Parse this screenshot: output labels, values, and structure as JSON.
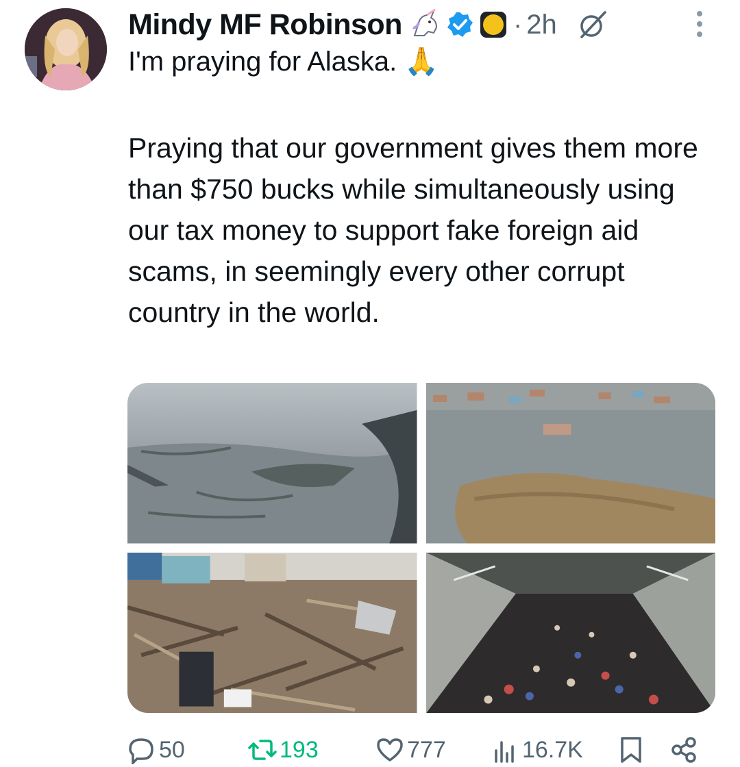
{
  "post": {
    "author": {
      "name": "Mindy MF Robinson",
      "verified": true
    },
    "time": "2h",
    "separator": "·",
    "first_line": "I'm praying for Alaska. 🙏",
    "body": "Praying that our government gives them more than $750 bucks while simultaneously using our tax money to support fake foreign aid scams, in seemingly every other corrupt country in the world."
  },
  "media": {
    "images": [
      {
        "name": "aerial-flooded-village"
      },
      {
        "name": "flooded-town-aerial"
      },
      {
        "name": "storm-debris-houses"
      },
      {
        "name": "cargo-plane-evacuees"
      }
    ]
  },
  "actions": {
    "replies": "50",
    "reposts": "193",
    "likes": "777",
    "views": "16.7K"
  },
  "colors": {
    "text": "#0f1419",
    "muted": "#536471",
    "verified": "#1d9bf0",
    "repost": "#00ba7c"
  },
  "icons": [
    "unicorn-icon",
    "verified-icon",
    "smiley-badge-icon",
    "grok-icon",
    "more-icon",
    "reply-icon",
    "repost-icon",
    "like-icon",
    "views-icon",
    "bookmark-icon",
    "share-icon"
  ]
}
